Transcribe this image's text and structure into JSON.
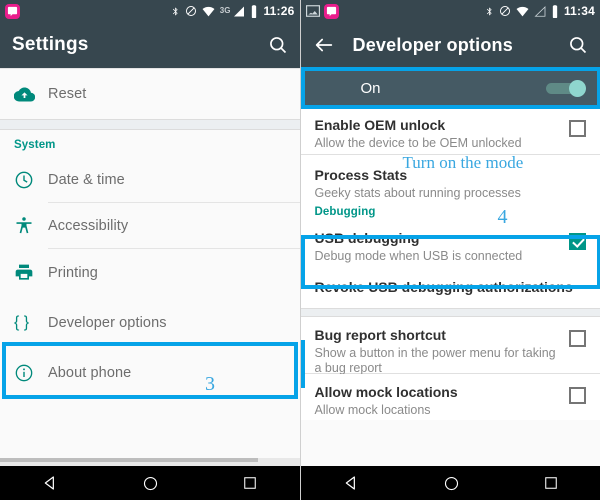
{
  "left": {
    "statusbar": {
      "time": "11:26",
      "network_label": "3G",
      "icons": [
        "chat-app-icon",
        "bluetooth-icon",
        "do-not-disturb-icon",
        "wifi-icon",
        "cellular-signal-icon",
        "battery-icon"
      ]
    },
    "appbar": {
      "title": "Settings",
      "search_icon": "search-icon"
    },
    "rows": [
      {
        "label": "Reset",
        "icon": "cloud-upload-icon"
      },
      {
        "label": "Date & time",
        "icon": "clock-icon"
      },
      {
        "label": "Accessibility",
        "icon": "accessibility-icon"
      },
      {
        "label": "Printing",
        "icon": "printer-icon"
      },
      {
        "label": "Developer options",
        "icon": "braces-icon"
      },
      {
        "label": "About phone",
        "icon": "info-icon"
      }
    ],
    "section_header": "System",
    "annotations": {
      "step": "3"
    },
    "navbar": {
      "back": "back-icon",
      "home": "home-icon",
      "recents": "recents-icon"
    }
  },
  "right": {
    "statusbar": {
      "time": "11:34",
      "icons": [
        "screenshot-icon",
        "chat-app-icon",
        "bluetooth-icon",
        "do-not-disturb-icon",
        "wifi-icon",
        "cellular-signal-icon",
        "battery-icon"
      ]
    },
    "appbar": {
      "title": "Developer options",
      "back_icon": "back-arrow-icon",
      "search_icon": "search-icon"
    },
    "master_switch": {
      "label": "On",
      "state": "on"
    },
    "section_header": "Debugging",
    "rows": [
      {
        "title": "Enable OEM unlock",
        "subtitle": "Allow the device to be OEM unlocked",
        "checked": false
      },
      {
        "title": "Process Stats",
        "subtitle": "Geeky stats about running processes",
        "checked": null
      },
      {
        "title": "USB debugging",
        "subtitle": "Debug mode when USB is connected",
        "checked": true
      },
      {
        "title": "Revoke USB debugging authorizations",
        "subtitle": "",
        "checked": null
      },
      {
        "title": "Bug report shortcut",
        "subtitle": "Show a button in the power menu for taking a bug report",
        "checked": false
      },
      {
        "title": "Allow mock locations",
        "subtitle": "Allow mock locations",
        "checked": false
      }
    ],
    "annotations": {
      "phrase": "Turn on the mode",
      "step": "4"
    },
    "navbar": {
      "back": "back-icon",
      "home": "home-icon",
      "recents": "recents-icon"
    }
  },
  "colors": {
    "annotation_blue": "#06a3e8",
    "annotation_text": "#39a7e0",
    "teal_accent": "#00897b",
    "appbar_bg": "#37474f",
    "switch_on": "#8fd6ce"
  }
}
